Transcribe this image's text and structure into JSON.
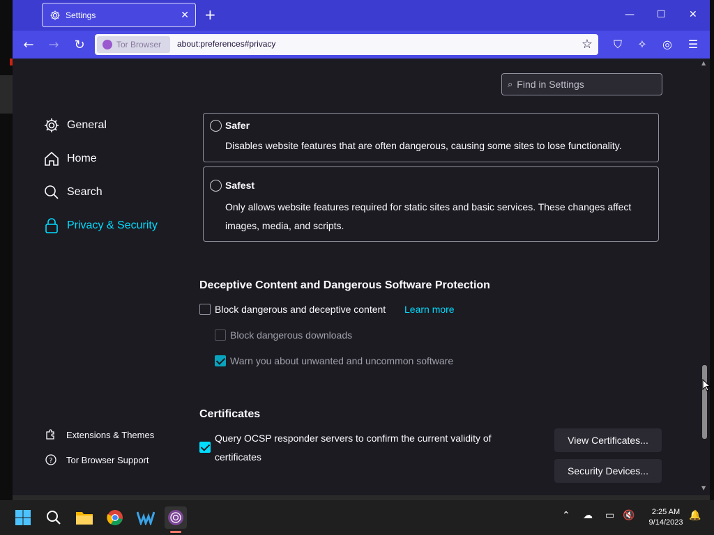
{
  "window": {
    "tab_title": "Settings",
    "new_tab_symbol": "+",
    "controls": [
      "—",
      "☐",
      "✕"
    ]
  },
  "toolbar": {
    "identity_label": "Tor Browser",
    "url": "about:preferences#privacy"
  },
  "search": {
    "placeholder": "Find in Settings"
  },
  "sidebar": {
    "categories": [
      {
        "label": "General",
        "icon": "gear-icon"
      },
      {
        "label": "Home",
        "icon": "home-icon"
      },
      {
        "label": "Search",
        "icon": "search-icon"
      },
      {
        "label": "Privacy & Security",
        "icon": "lock-icon",
        "active": true
      }
    ],
    "footer": [
      {
        "label": "Extensions & Themes",
        "icon": "puzzle-icon"
      },
      {
        "label": "Tor Browser Support",
        "icon": "help-icon"
      }
    ]
  },
  "security_levels": [
    {
      "title": "Safer",
      "description": "Disables website features that are often dangerous, causing some sites to lose functionality.",
      "selected": false
    },
    {
      "title": "Safest",
      "description_line1": "Only allows website features required for static sites and basic services. These changes affect",
      "description_line2": "images, media, and scripts.",
      "selected": false
    }
  ],
  "deceptive": {
    "heading": "Deceptive Content and Dangerous Software Protection",
    "block_label": "Block dangerous and deceptive content",
    "block_checked": false,
    "learn_more": "Learn more",
    "downloads_label": "Block dangerous downloads",
    "downloads_checked": false,
    "unwanted_label": "Warn you about unwanted and uncommon software",
    "unwanted_checked": true
  },
  "certificates": {
    "heading": "Certificates",
    "ocsp_line1": "Query OCSP responder servers to confirm the current validity of",
    "ocsp_line2": "certificates",
    "ocsp_checked": true,
    "view_button": "View Certificates...",
    "devices_button": "Security Devices..."
  },
  "taskbar": {
    "time": "2:25 AM",
    "date": "9/14/2023",
    "apps": [
      "windows-start-icon",
      "search-icon",
      "file-explorer-icon",
      "chrome-icon",
      "wavebox-icon",
      "tor-browser-icon"
    ]
  },
  "colors": {
    "titlebar": "#3c3cd0",
    "navbar": "#4a4ae6",
    "accent": "#00ddff",
    "page_bg": "#1c1b22"
  }
}
